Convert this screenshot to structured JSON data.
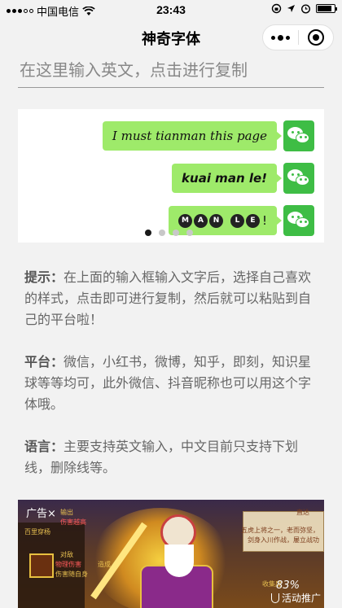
{
  "status_bar": {
    "carrier": "中国电信",
    "time": "23:43",
    "battery_level": 0.85,
    "icons": [
      "signal-dots-icon",
      "wifi-icon",
      "rotation-lock-icon",
      "location-arrow-icon",
      "alarm-icon",
      "battery-icon"
    ]
  },
  "nav": {
    "title": "神奇字体",
    "more_icon": "more-dots-icon",
    "close_icon": "target-circle-icon"
  },
  "input": {
    "placeholder": "在这里输入英文，点击进行复制",
    "value": ""
  },
  "samples": [
    {
      "text": "I must tianman this page"
    },
    {
      "text": "kuai man le!"
    },
    {
      "letters": [
        "M",
        "A",
        "N",
        "L",
        "E"
      ],
      "suffix": "!"
    }
  ],
  "carousel": {
    "page_count": 4,
    "active_index": 0
  },
  "tips": [
    {
      "label": "提示：",
      "text": "在上面的输入框输入文字后，选择自己喜欢的样式，点击即可进行复制，然后就可以粘贴到自己的平台啦！"
    },
    {
      "label": "平台：",
      "text": "微信，小红书，微博，知乎，即刻，知识星球等等均可，此外微信、抖音昵称也可以用这个字体哦。"
    },
    {
      "label": "语言：",
      "text": "主要支持英文输入，中文目前只支持下划线，删除线等。"
    }
  ],
  "ad": {
    "label": "广告",
    "close": "×",
    "percent": "83%",
    "promo": "活动推广",
    "small_texts": [
      "输出",
      "伤害越高",
      "百里穿杨",
      "物理伤害",
      "伤害随自身",
      "造成",
      "对敌",
      "直达",
      "五虎上将之一，老而弥坚，",
      "剑身入川作战，屡立战功",
      "收集度"
    ]
  }
}
